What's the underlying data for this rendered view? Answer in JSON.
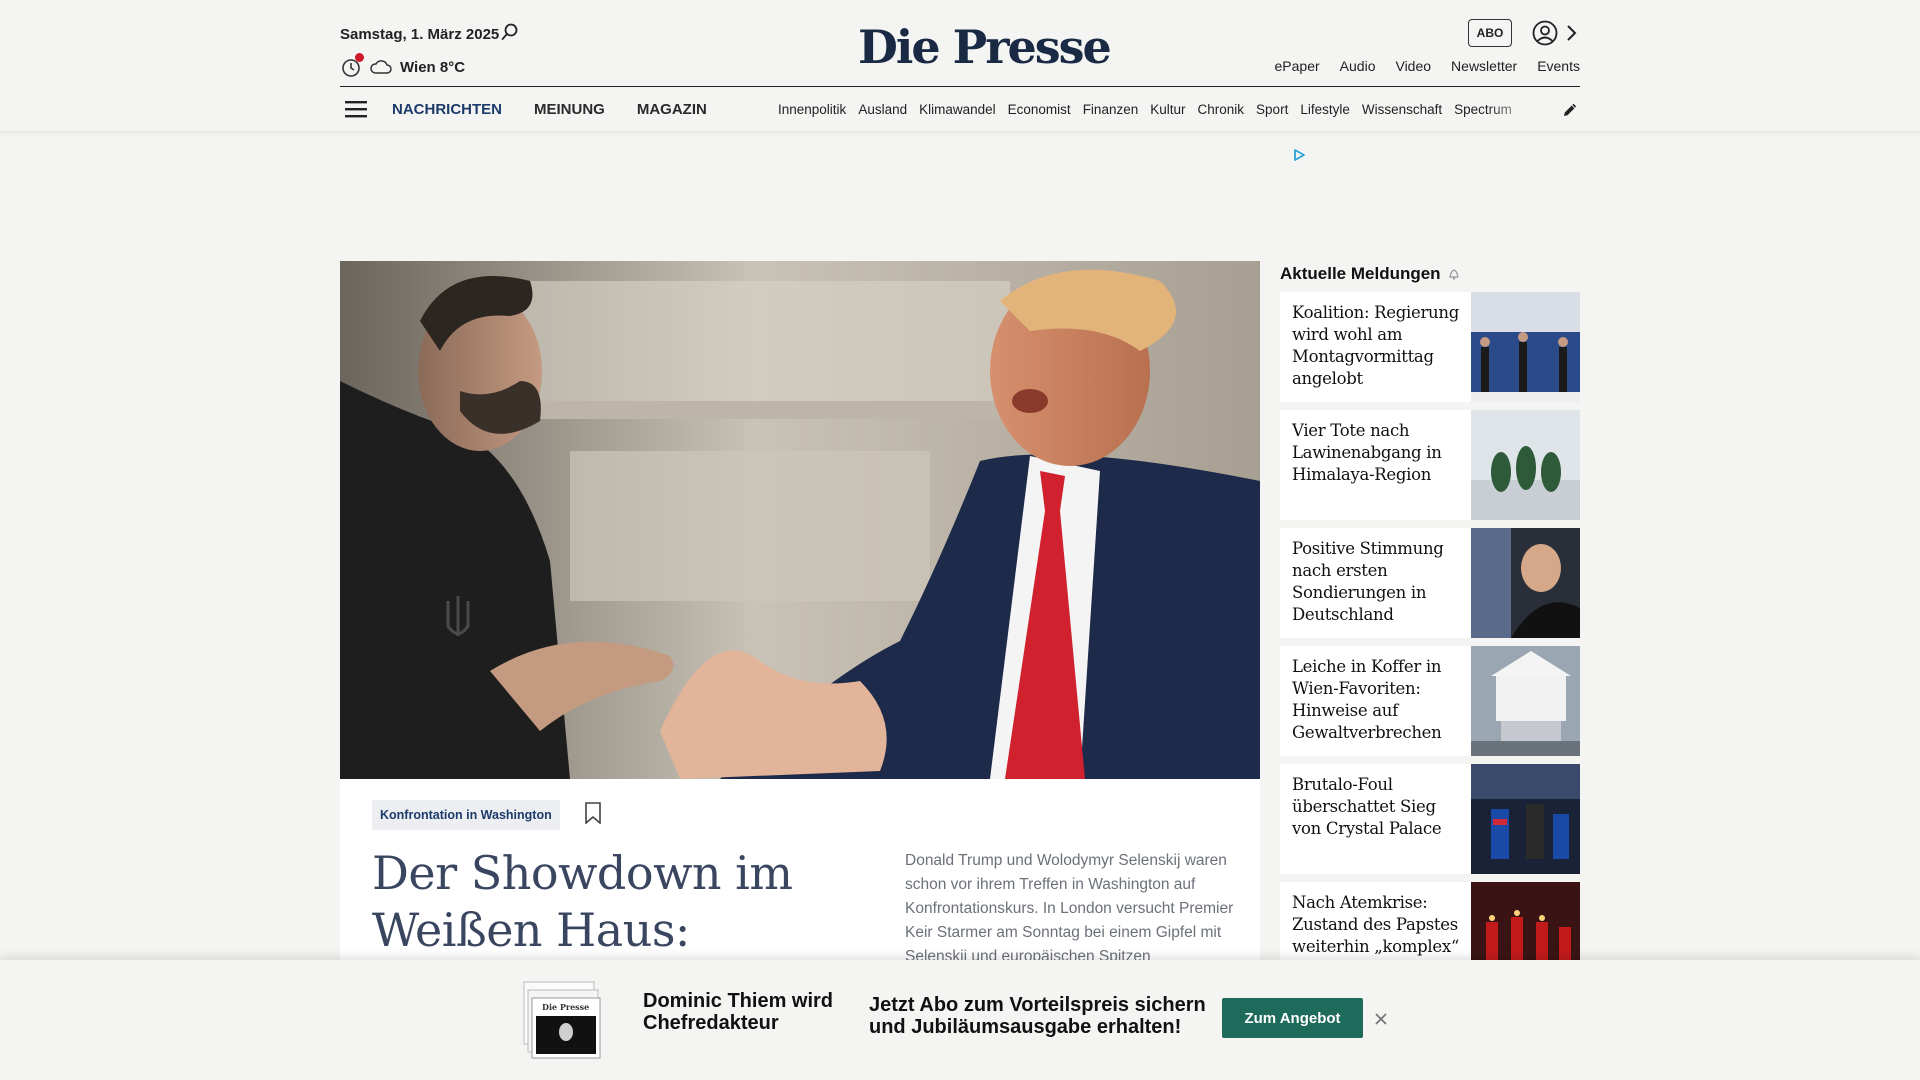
{
  "header": {
    "date": "Samstag, 1. März 2025",
    "weather": "Wien 8°C",
    "logo": "Die Presse",
    "abo_label": "ABO",
    "links": [
      "ePaper",
      "Audio",
      "Video",
      "Newsletter",
      "Events"
    ]
  },
  "nav": {
    "main": [
      "NACHRICHTEN",
      "MEINUNG",
      "MAGAZIN"
    ],
    "sub": [
      "Innenpolitik",
      "Ausland",
      "Klimawandel",
      "Economist",
      "Finanzen",
      "Kultur",
      "Chronik",
      "Sport",
      "Lifestyle",
      "Wissenschaft",
      "Spectrum"
    ]
  },
  "hero": {
    "tag": "Konfrontation in Washington",
    "headline": "Der Showdown im Weißen Haus: Anatomie",
    "teaser": "Donald Trump und Wolodymyr Selenskij waren schon vor ihrem Treffen in Washington auf Konfrontationskurs. In London versucht Premier Keir Starmer am Sonntag bei einem Gipfel mit Selenskij und europäischen Spitzen"
  },
  "sidebar": {
    "title": "Aktuelle Meldungen",
    "items": [
      {
        "title": "Koalition: Regierung wird wohl am Montagvormittag angelobt"
      },
      {
        "title": "Vier Tote nach Lawinenabgang in Himalaya-Region"
      },
      {
        "title": "Positive Stimmung nach ersten Sondierungen in Deutschland"
      },
      {
        "title": "Leiche in Koffer in Wien-Favoriten: Hinweise auf Gewaltverbrechen"
      },
      {
        "title": "Brutalo-Foul überschattet Sieg von Crystal Palace"
      },
      {
        "title": "Nach Atemkrise: Zustand des Papstes weiterhin „komplex“"
      }
    ]
  },
  "banner": {
    "name": "Dominic Thiem wird Chefredakteur",
    "text": "Jetzt Abo zum Vorteilspreis sichern und Jubiläumsausgabe erhalten!",
    "button": "Zum Angebot",
    "newspaper_logo": "Die Presse"
  },
  "colors": {
    "accent_navy": "#1c3b6b",
    "cta_green": "#1e6b5b",
    "live_red": "#d0182b"
  }
}
